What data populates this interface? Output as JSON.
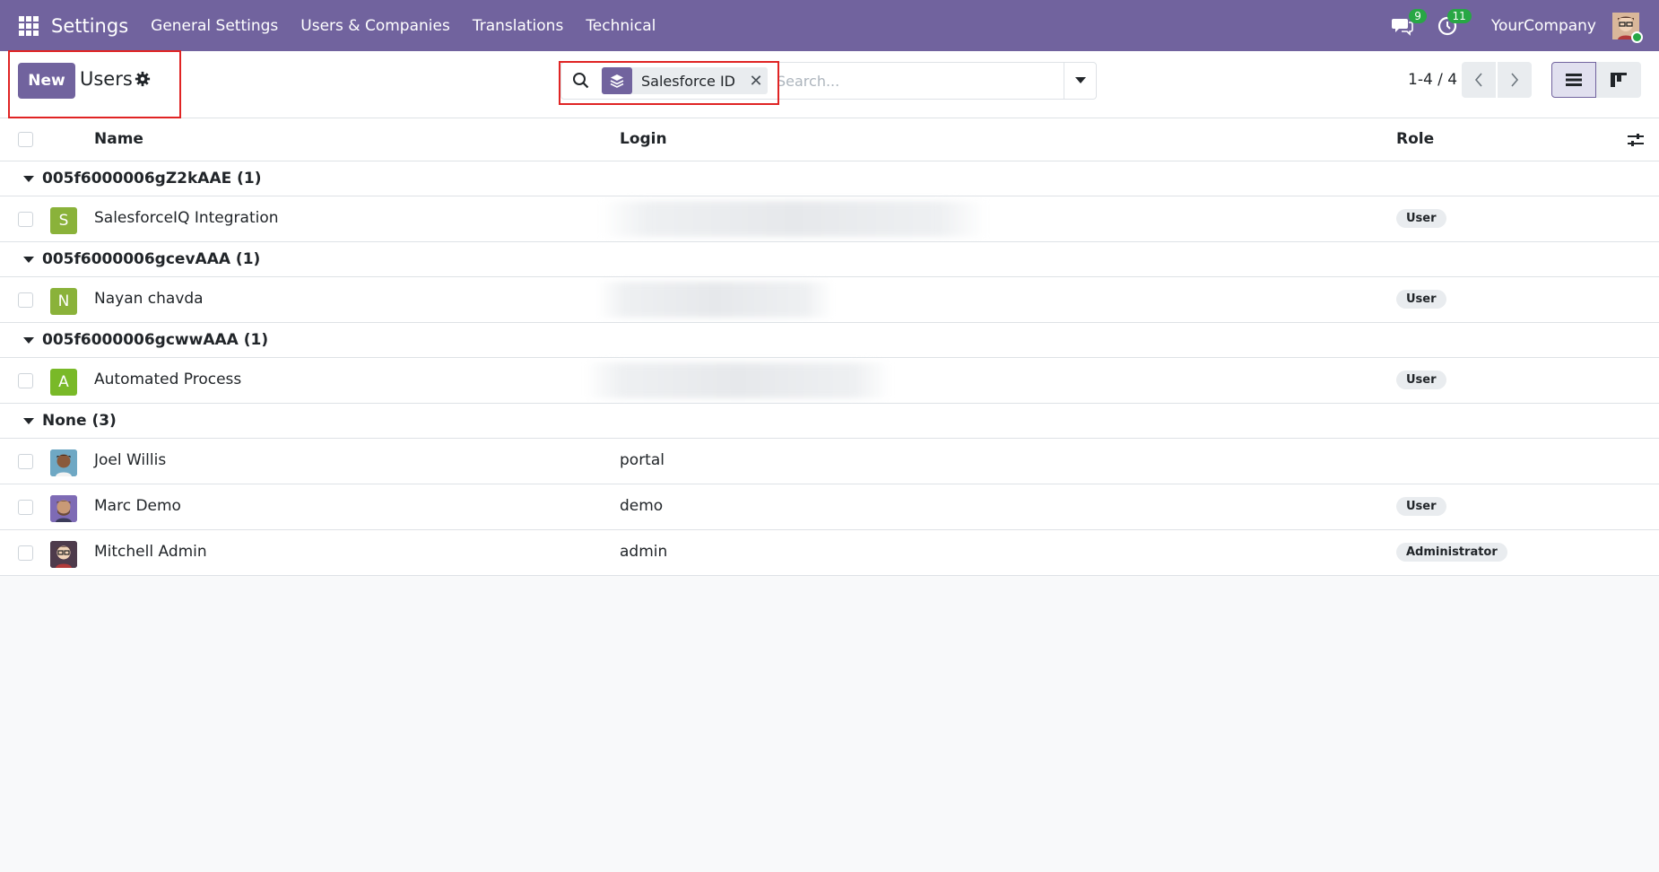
{
  "navbar": {
    "brand": "Settings",
    "menu": [
      "General Settings",
      "Users & Companies",
      "Translations",
      "Technical"
    ],
    "messages_count": "9",
    "activities_count": "11",
    "company": "YourCompany",
    "color": "#71639e"
  },
  "control": {
    "new_label": "New",
    "title": "Users",
    "facet_label": "Salesforce ID",
    "search_placeholder": "Search...",
    "pager": "1-4 / 4"
  },
  "table": {
    "columns": {
      "name": "Name",
      "login": "Login",
      "role": "Role"
    },
    "groups": [
      {
        "label": "005f6000006gZ2kAAE (1)",
        "rows": [
          {
            "avatar_letter": "S",
            "avatar_color": "#8ab23a",
            "name": "SalesforceIQ Integration",
            "login": "",
            "role": "User"
          }
        ]
      },
      {
        "label": "005f6000006gcevAAA (1)",
        "rows": [
          {
            "avatar_letter": "N",
            "avatar_color": "#8ab23a",
            "name": "Nayan chavda",
            "login": "",
            "role": "User"
          }
        ]
      },
      {
        "label": "005f6000006gcwwAAA (1)",
        "rows": [
          {
            "avatar_letter": "A",
            "avatar_color": "#79b928",
            "name": "Automated Process",
            "login": "",
            "role": "User"
          }
        ]
      },
      {
        "label": "None (3)",
        "rows": [
          {
            "avatar_letter": "",
            "avatar_color": "#6fa8c4",
            "name": "Joel Willis",
            "login": "portal",
            "role": ""
          },
          {
            "avatar_letter": "",
            "avatar_color": "#7e6bb5",
            "name": "Marc Demo",
            "login": "demo",
            "role": "User"
          },
          {
            "avatar_letter": "",
            "avatar_color": "#4e3b4c",
            "name": "Mitchell Admin",
            "login": "admin",
            "role": "Administrator"
          }
        ]
      }
    ]
  }
}
